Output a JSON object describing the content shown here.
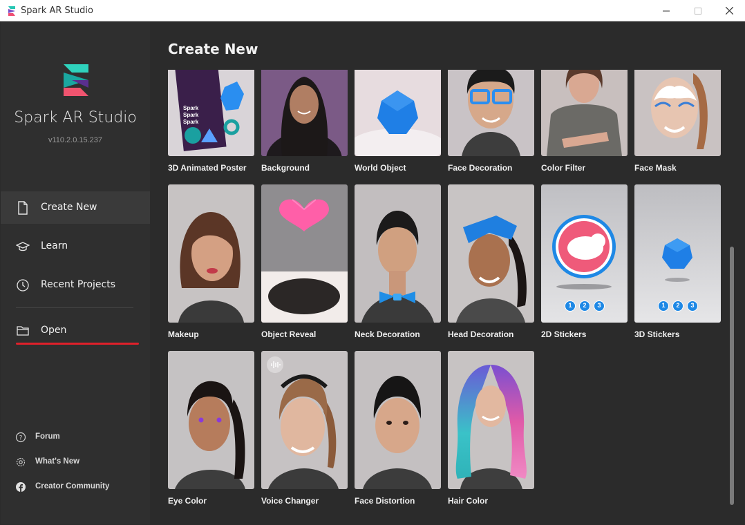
{
  "window": {
    "title": "Spark AR Studio"
  },
  "sidebar": {
    "brand": "Spark AR Studio",
    "version": "v110.2.0.15.237",
    "nav": [
      {
        "label": "Create New",
        "icon": "document-icon",
        "active": true
      },
      {
        "label": "Learn",
        "icon": "graduation-cap-icon",
        "active": false
      },
      {
        "label": "Recent Projects",
        "icon": "clock-icon",
        "active": false
      },
      {
        "label": "Open",
        "icon": "folder-icon",
        "active": false
      }
    ],
    "footer": [
      {
        "label": "Forum",
        "icon": "question-circle-icon"
      },
      {
        "label": "What's New",
        "icon": "gear-icon"
      },
      {
        "label": "Creator Community",
        "icon": "facebook-icon"
      }
    ]
  },
  "main": {
    "title": "Create New",
    "templates": [
      {
        "label": "3D Animated Poster"
      },
      {
        "label": "Background"
      },
      {
        "label": "World Object"
      },
      {
        "label": "Face Decoration"
      },
      {
        "label": "Color Filter"
      },
      {
        "label": "Face Mask"
      },
      {
        "label": "Makeup"
      },
      {
        "label": "Object Reveal"
      },
      {
        "label": "Neck Decoration"
      },
      {
        "label": "Head Decoration"
      },
      {
        "label": "2D Stickers",
        "steps": [
          "1",
          "2",
          "3"
        ]
      },
      {
        "label": "3D Stickers",
        "steps": [
          "1",
          "2",
          "3"
        ]
      },
      {
        "label": "Eye Color"
      },
      {
        "label": "Voice Changer"
      },
      {
        "label": "Face Distortion"
      },
      {
        "label": "Hair Color"
      }
    ],
    "poster_text": [
      "Spark",
      "Spark",
      "Spark"
    ]
  },
  "colors": {
    "accent_red": "#e0202a",
    "sidebar_bg": "#2f2f2f",
    "main_bg": "#2b2b2b",
    "sticker_blue": "#1e88e5",
    "sticker_pink": "#ef5a7a"
  }
}
